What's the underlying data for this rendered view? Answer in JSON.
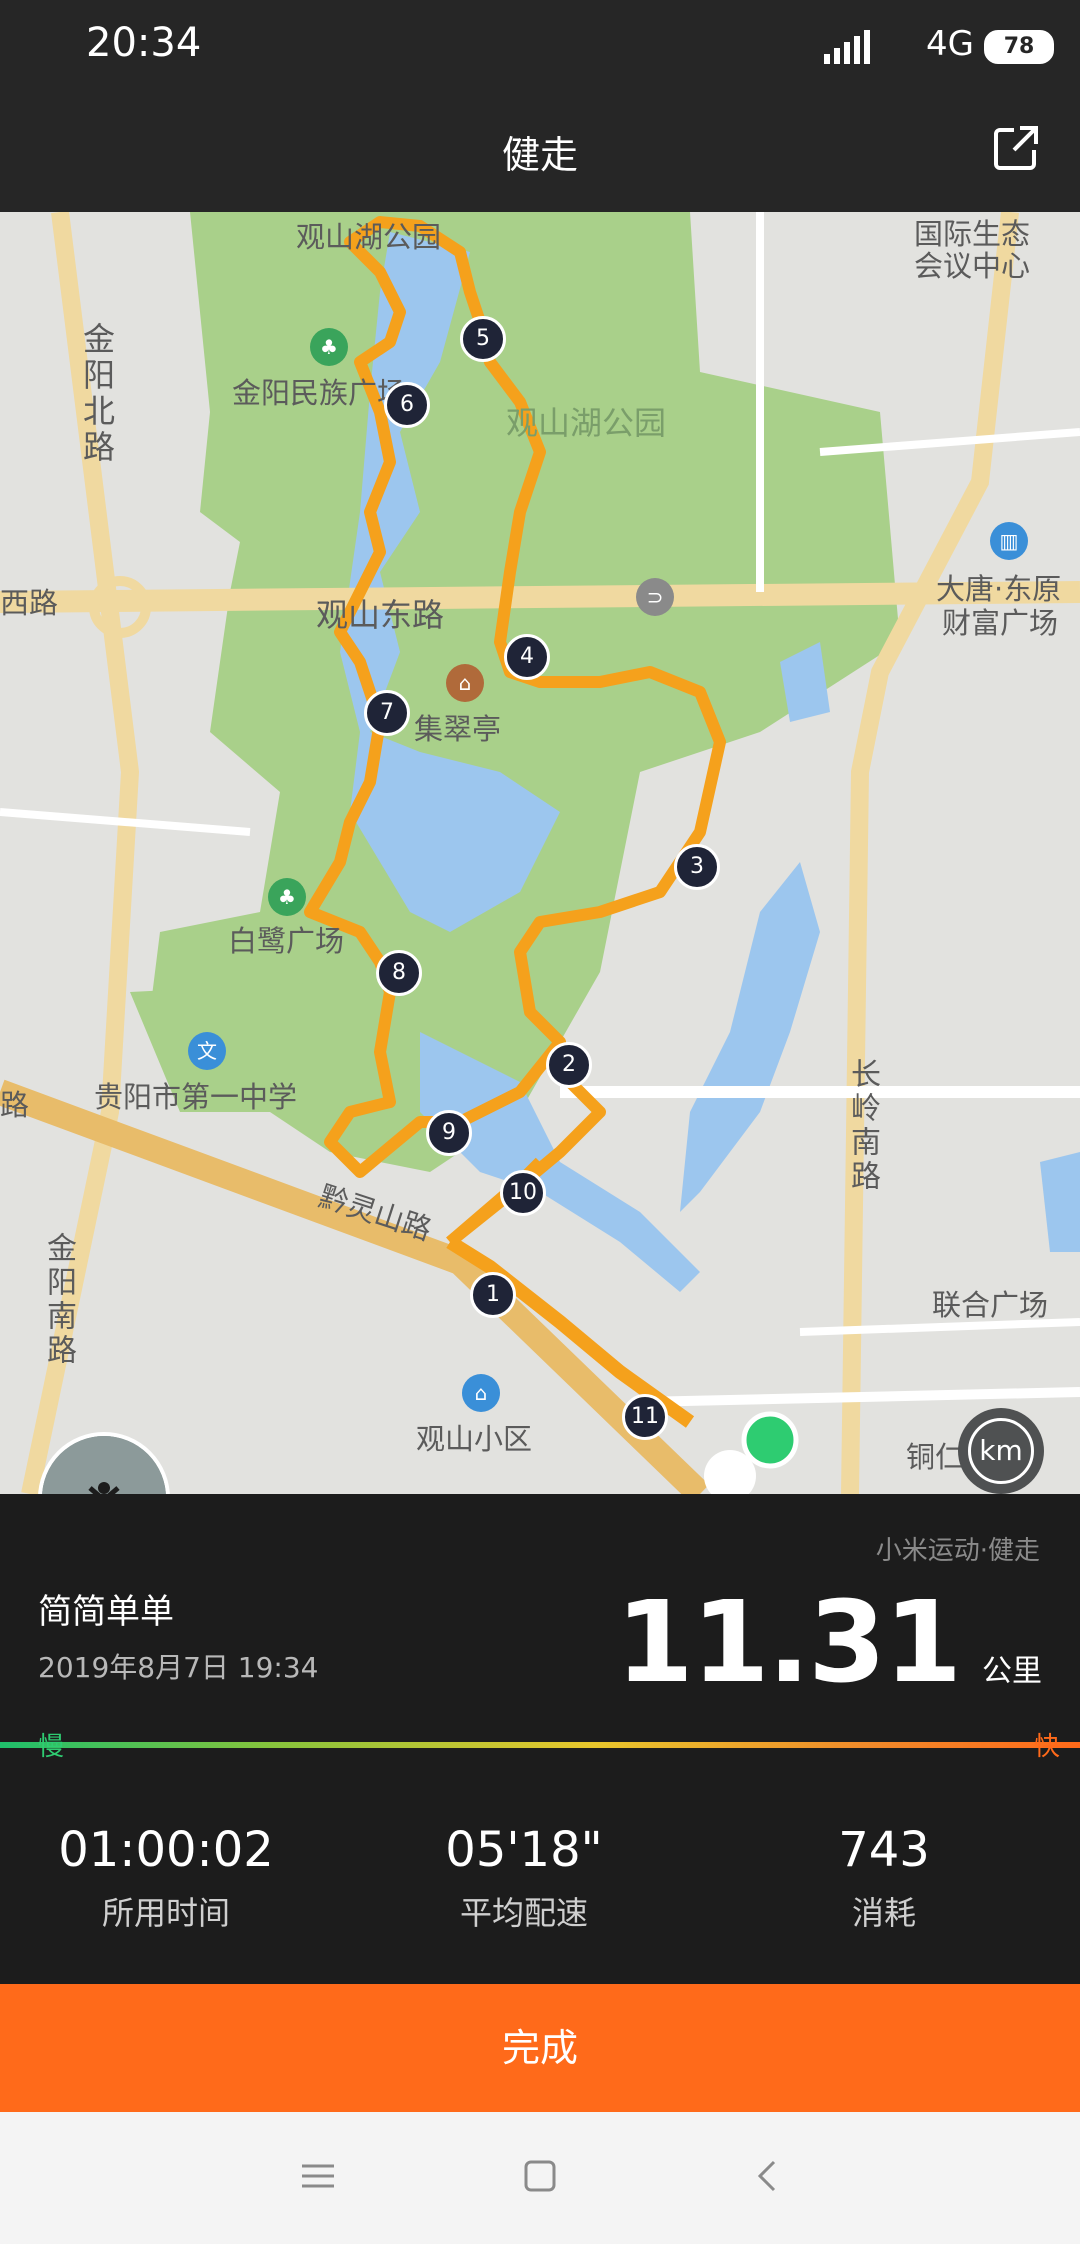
{
  "status_bar": {
    "time": "20:34",
    "network": "4G",
    "battery": "78"
  },
  "header": {
    "title": "健走",
    "share_icon": "share-icon"
  },
  "map": {
    "labels": {
      "guanshanhu_top": "观山湖公园",
      "guoji": "国际生态会议中心",
      "jinyang_minzu": "金阳民族广场",
      "guanshanhu_mid": "观山湖公园",
      "dalu_left": "西路",
      "guanshan_donglu": "观山东路",
      "datang": "大唐·东原",
      "caifu": "财富广场",
      "jicui": "集翠亭",
      "bailu": "白鹭广场",
      "yizhong": "贵阳市第一中学",
      "lu_left": "路",
      "qianling": "黔灵山路",
      "lianhe": "联合广场",
      "guanshan_xiaoqu": "观山小区",
      "tongren": "铜仁路",
      "jinyang_bei": "金阳北路",
      "jinyang_nan": "金阳南路",
      "changling_nan": "长岭南路",
      "road_tag": "路"
    },
    "km_markers": [
      "1",
      "2",
      "3",
      "4",
      "5",
      "6",
      "7",
      "8",
      "9",
      "10",
      "11"
    ],
    "km_button": "km"
  },
  "summary": {
    "brand": "小米运动·健走",
    "user": "简简单单",
    "datetime": "2019年8月7日 19:34",
    "distance": "11.31",
    "distance_unit": "公里",
    "slow_label": "慢",
    "fast_label": "快",
    "stats": [
      {
        "value": "01:00:02",
        "label": "所用时间"
      },
      {
        "value": "05'18\"",
        "label": "平均配速"
      },
      {
        "value": "743",
        "label": "消耗"
      }
    ]
  },
  "footer": {
    "done": "完成"
  },
  "colors": {
    "accent": "#ff6a1a",
    "route": "#f5a11c",
    "park": "#a9d08a",
    "water": "#9cc6ee"
  }
}
